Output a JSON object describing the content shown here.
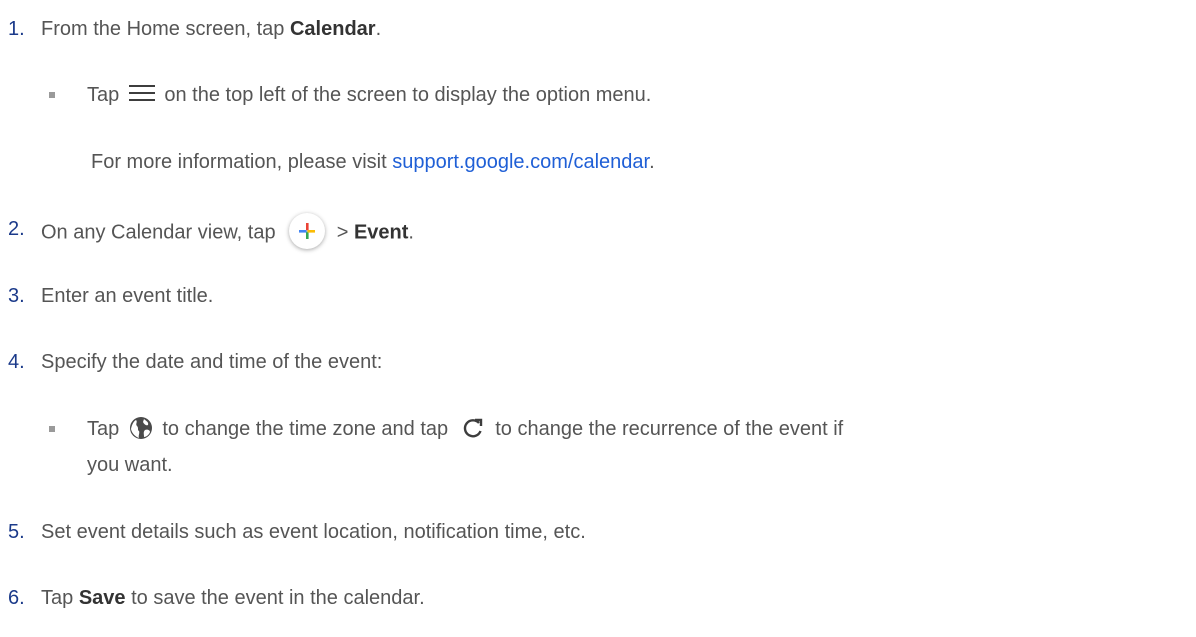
{
  "steps": [
    {
      "number": "1.",
      "pre": "From the Home screen, tap ",
      "bold": "Calendar",
      "post": "."
    },
    {
      "number": "2.",
      "pre": "On any Calendar view, tap ",
      "mid": " > ",
      "bold": "Event",
      "post": "."
    },
    {
      "number": "3.",
      "text": "Enter an event title."
    },
    {
      "number": "4.",
      "text": "Specify the date and time of the event:"
    },
    {
      "number": "5.",
      "text": "Set event details such as event location, notification time, etc."
    },
    {
      "number": "6.",
      "pre": "Tap ",
      "bold": "Save",
      "post": " to save the event in the calendar."
    }
  ],
  "sub_step_1": {
    "pre": "Tap ",
    "post": " on the top left of the screen to display the option menu.",
    "icon": "menu-icon"
  },
  "info_note": {
    "pre": "For more information, please visit ",
    "link_text": "support.google.com/calendar",
    "post": "."
  },
  "sub_step_4": {
    "pre": "Tap ",
    "mid": " to change the time zone and tap ",
    "post_line1": " to change the recurrence of the event if",
    "line2": "you want.",
    "icons": [
      "globe-icon",
      "recurrence-icon"
    ]
  },
  "colors": {
    "link": "#1f5fd6",
    "step_number": "#1b3a8a",
    "body_text": "#555555"
  }
}
